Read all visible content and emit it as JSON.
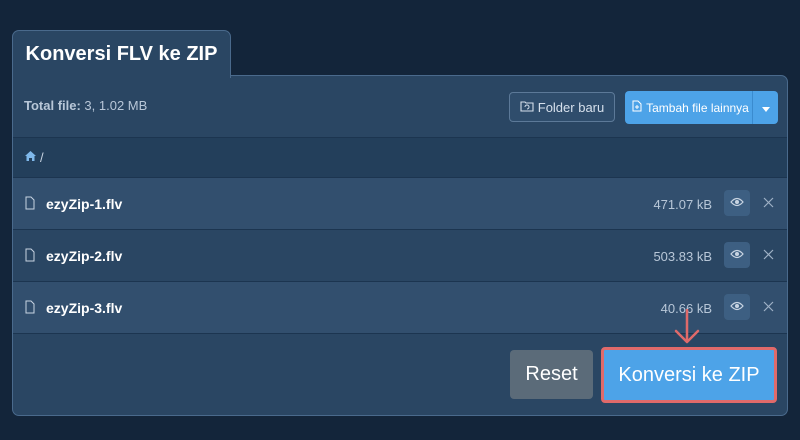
{
  "tab": {
    "title": "Konversi FLV ke ZIP"
  },
  "toolbar": {
    "total_label": "Total file:",
    "total_value": " 3, 1.02 MB",
    "folder_button": "Folder baru",
    "add_button": "Tambah file lainnya"
  },
  "breadcrumb": {
    "separator": "/"
  },
  "files": [
    {
      "name": "ezyZip-1.flv",
      "size": "471.07 kB"
    },
    {
      "name": "ezyZip-2.flv",
      "size": "503.83 kB"
    },
    {
      "name": "ezyZip-3.flv",
      "size": "40.66 kB"
    }
  ],
  "actions": {
    "reset": "Reset",
    "convert": "Konversi ke ZIP"
  },
  "colors": {
    "background": "#13253a",
    "panel": "#2a4663",
    "accent": "#4da3e8",
    "highlight": "#e06a6a",
    "reset": "#5b6b79"
  },
  "icons": {
    "folder_button": "folder-refresh-icon",
    "add_button": "file-plus-icon",
    "breadcrumb": "home-icon",
    "file": "file-icon",
    "preview": "eye-icon",
    "remove": "close-icon",
    "pointer": "arrow-down-icon"
  }
}
